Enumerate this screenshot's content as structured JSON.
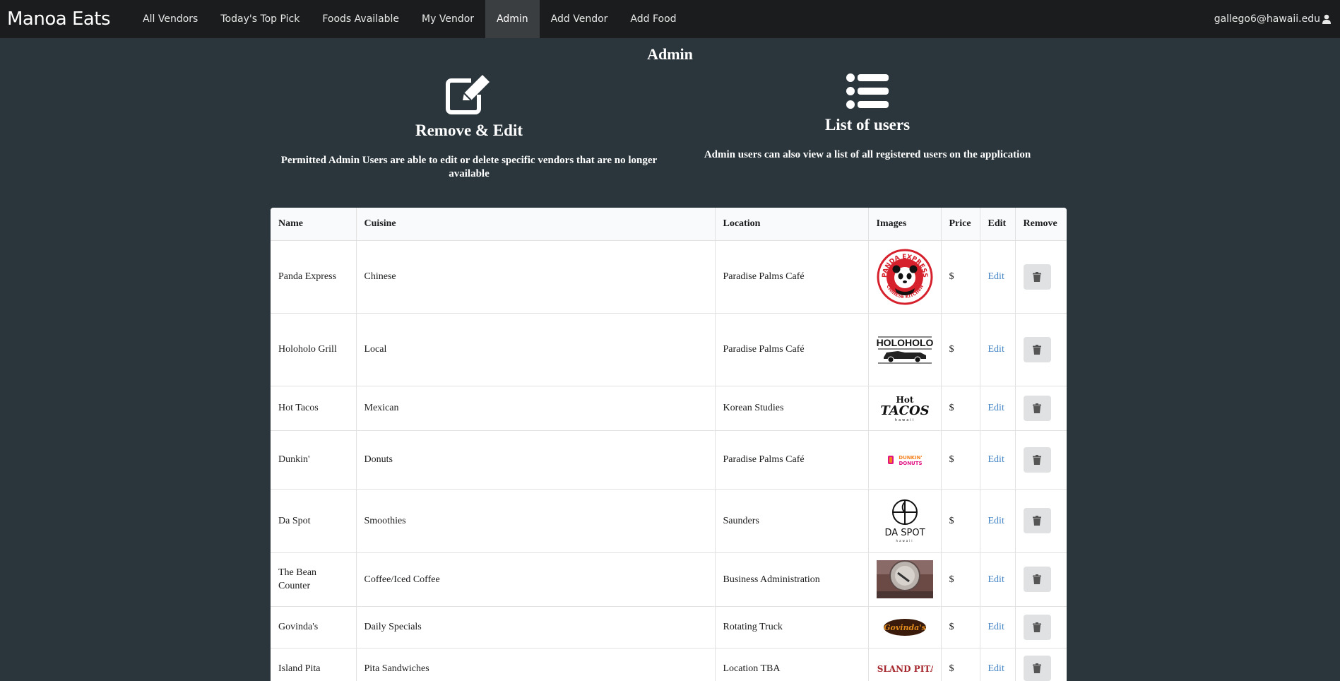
{
  "nav": {
    "brand": "Manoa Eats",
    "items": [
      {
        "label": "All Vendors"
      },
      {
        "label": "Today's Top Pick"
      },
      {
        "label": "Foods Available"
      },
      {
        "label": "My Vendor"
      },
      {
        "label": "Admin"
      },
      {
        "label": "Add Vendor"
      },
      {
        "label": "Add Food"
      }
    ],
    "active": "Admin",
    "user": "gallego6@hawaii.edu"
  },
  "page": {
    "title": "Admin",
    "features": [
      {
        "icon": "edit-icon",
        "title": "Remove & Edit",
        "text": "Permitted Admin Users are able to edit or delete specific vendors that are no longer available"
      },
      {
        "icon": "list-icon",
        "title": "List of users",
        "text": "Admin users can also view a list of all registered users on the application"
      }
    ]
  },
  "table": {
    "headers": [
      "Name",
      "Cuisine",
      "Location",
      "Images",
      "Price",
      "Edit",
      "Remove"
    ],
    "rows": [
      {
        "name": "Panda Express",
        "cuisine": "Chinese",
        "location": "Paradise Palms Café",
        "logo": "panda-express-logo",
        "price": "$",
        "edit": "Edit"
      },
      {
        "name": "Holoholo Grill",
        "cuisine": "Local",
        "location": "Paradise Palms Café",
        "logo": "holoholo-logo",
        "price": "$",
        "edit": "Edit"
      },
      {
        "name": "Hot Tacos",
        "cuisine": "Mexican",
        "location": "Korean Studies",
        "logo": "hot-tacos-logo",
        "price": "$",
        "edit": "Edit"
      },
      {
        "name": "Dunkin'",
        "cuisine": "Donuts",
        "location": "Paradise Palms Café",
        "logo": "dunkin-logo",
        "price": "$",
        "edit": "Edit"
      },
      {
        "name": "Da Spot",
        "cuisine": "Smoothies",
        "location": "Saunders",
        "logo": "da-spot-logo",
        "price": "$",
        "edit": "Edit"
      },
      {
        "name": "The Bean Counter",
        "cuisine": "Coffee/Iced Coffee",
        "location": "Business Administration",
        "logo": "bean-counter-logo",
        "price": "$",
        "edit": "Edit"
      },
      {
        "name": "Govinda's",
        "cuisine": "Daily Specials",
        "location": "Rotating Truck",
        "logo": "govindas-logo",
        "price": "$",
        "edit": "Edit"
      },
      {
        "name": "Island Pita",
        "cuisine": "Pita Sandwiches",
        "location": "Location TBA",
        "logo": "island-pita-logo",
        "price": "$",
        "edit": "Edit"
      }
    ]
  },
  "logo_text": {
    "panda_top": "PANDA EXPRESS",
    "panda_bottom": "CHINESE KITCHEN",
    "holoholo": "HOLOHOLO",
    "hot": "Hot",
    "tacos": "TACOS",
    "hawaii": "hawaii",
    "dunkin": "DUNKIN'",
    "donuts": "DONUTS",
    "daspot": "DA SPOT",
    "govindas": "Govinda's",
    "islandpita": "ISLAND PITA"
  },
  "colors": {
    "page_bg": "#2a363c",
    "navbar_bg": "#1b1c1d",
    "link": "#4183c4",
    "panda_red": "#d6202c",
    "dunkin_orange": "#f5821f",
    "dunkin_pink": "#e11383",
    "govindas_orange": "#e08a1e"
  }
}
